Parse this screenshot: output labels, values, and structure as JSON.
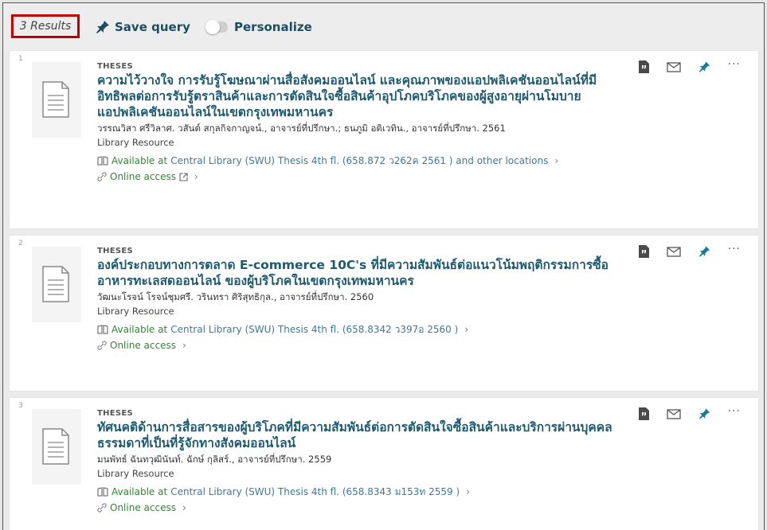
{
  "toolbar": {
    "results_count": "3 Results",
    "save_query_label": "Save query",
    "personalize_label": "Personalize"
  },
  "results": [
    {
      "index": "1",
      "type": "THESES",
      "title": "ความไว้วางใจ การรับรู้โฆษณาผ่านสื่อสังคมออนไลน์ และคุณภาพของแอปพลิเคชันออนไลน์ที่มีอิทธิพลต่อการรับรู้ตราสินค้าและการตัดสินใจซื้อสินค้าอุปโภคบริโภคของผู้สูงอายุผ่านโมบายแอปพลิเคชันออนไลน์ในเขตกรุงเทพมหานคร",
      "author": "วรรณวิสา ศรีวิลาศ. วสันต์ สกุลกิจกาญจน์., อาจารย์ที่ปรึกษา.; ธนภูมิ อติเวทิน., อาจารย์ที่ปรึกษา. 2561",
      "resource_type": "Library Resource",
      "availability_status": "Available at",
      "availability_location": "Central Library (SWU)  Thesis 4th fl. (658.872 ว262ค 2561 ) and other locations",
      "online_access": "Online access"
    },
    {
      "index": "2",
      "type": "THESES",
      "title": "องค์ประกอบทางการตลาด E-commerce 10C's ที่มีความสัมพันธ์ต่อแนวโน้มพฤติกรรมการซื้ออาหารทะเลสดออนไลน์ ของผู้บริโภคในเขตกรุงเทพมหานคร",
      "author": "วัฒนะโรจน์ โรจน์ชุมศรี. วรินทรา ศิริสุทธิกุล., อาจารย์ที่ปรึกษา. 2560",
      "resource_type": "Library Resource",
      "availability_status": "Available at",
      "availability_location": "Central Library (SWU)  Thesis 4th fl. (658.8342 ว397อ 2560 )",
      "online_access": "Online access"
    },
    {
      "index": "3",
      "type": "THESES",
      "title": "ทัศนคติด้านการสื่อสารของผู้บริโภคที่มีความสัมพันธ์ต่อการตัดสินใจซื้อสินค้าและบริการผ่านบุคคลธรรมดาที่เป็นที่รู้จักทางสังคมออนไลน์",
      "author": "มนพัทธ์ ฉันทวุฒินันท์. ฉักษ์ กุลิสร์., อาจารย์ที่ปรึกษา. 2559",
      "resource_type": "Library Resource",
      "availability_status": "Available at",
      "availability_location": "Central Library (SWU)  Thesis 4th fl. (658.8343 ม153ท 2559 )",
      "online_access": "Online access"
    }
  ],
  "icons": {
    "citation": "citation-icon",
    "email": "email-icon",
    "pin": "pin-icon",
    "more": "more-actions-icon"
  },
  "colors": {
    "title": "#1b5a70",
    "available": "#2d8a2d",
    "location": "#3a7b9a",
    "results_highlight": "#c00000"
  }
}
